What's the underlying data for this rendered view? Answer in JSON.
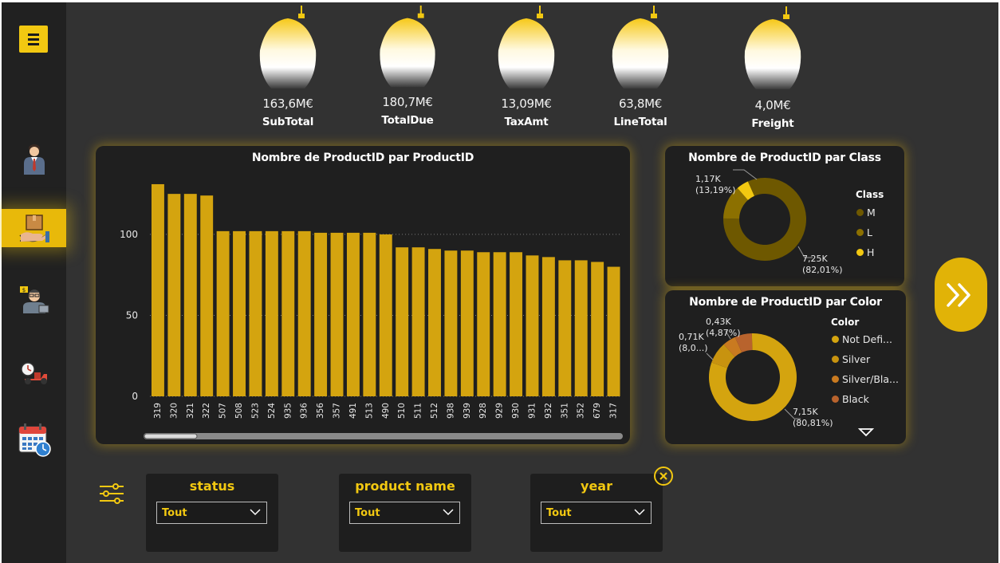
{
  "kpis": [
    {
      "value": "163,6M€",
      "label": "SubTotal"
    },
    {
      "value": "180,7M€",
      "label": "TotalDue"
    },
    {
      "value": "13,09M€",
      "label": "TaxAmt"
    },
    {
      "value": "63,8M€",
      "label": "LineTotal"
    },
    {
      "value": "4,0M€",
      "label": "Freight"
    }
  ],
  "sidebar": {
    "items": [
      {
        "icon": "businessman-icon"
      },
      {
        "icon": "product-delivery-icon",
        "active": true
      },
      {
        "icon": "seller-icon"
      },
      {
        "icon": "delivery-scooter-icon"
      },
      {
        "icon": "calendar-clock-icon"
      }
    ]
  },
  "filters": [
    {
      "title": "status",
      "value": "Tout"
    },
    {
      "title": "product name",
      "value": "Tout"
    },
    {
      "title": "year",
      "value": "Tout"
    }
  ],
  "chart_data": [
    {
      "type": "bar",
      "title": "Nombre de ProductID par ProductID",
      "xlabel": "",
      "ylabel": "",
      "ylim": [
        0,
        130
      ],
      "yticks": [
        0,
        50,
        100
      ],
      "categories": [
        "319",
        "320",
        "321",
        "322",
        "507",
        "508",
        "523",
        "524",
        "935",
        "936",
        "356",
        "357",
        "491",
        "513",
        "490",
        "510",
        "511",
        "512",
        "938",
        "939",
        "928",
        "929",
        "930",
        "931",
        "932",
        "351",
        "352",
        "679",
        "317"
      ],
      "values": [
        131,
        125,
        125,
        124,
        102,
        102,
        102,
        102,
        102,
        102,
        101,
        101,
        101,
        101,
        100,
        92,
        92,
        91,
        90,
        90,
        89,
        89,
        89,
        87,
        86,
        84,
        84,
        83,
        80
      ],
      "bar_color": "#d4a40f",
      "grid": "dotted at 50 and 100"
    },
    {
      "type": "pie",
      "donut": true,
      "title": "Nombre de ProductID par Class",
      "legend_title": "Class",
      "legend_position": "right",
      "categories": [
        "M",
        "L",
        "H"
      ],
      "values": [
        7250,
        1170,
        420
      ],
      "colors": [
        "#6e5800",
        "#8c7000",
        "#f2c811"
      ],
      "labels": [
        {
          "value": "7,25K",
          "pct": "(82,01%)"
        },
        {
          "value": "1,17K",
          "pct": "(13,19%)"
        }
      ]
    },
    {
      "type": "pie",
      "donut": true,
      "title": "Nombre de ProductID par Color",
      "legend_title": "Color",
      "legend_position": "right",
      "categories": [
        "Not Defi...",
        "Silver",
        "Silver/Bla...",
        "Black"
      ],
      "values": [
        7150,
        710,
        430,
        560
      ],
      "colors": [
        "#d4a40f",
        "#c8930f",
        "#c97a20",
        "#b8632d"
      ],
      "labels": [
        {
          "value": "7,15K",
          "pct": "(80,81%)"
        },
        {
          "value": "0,71K",
          "pct": "(8,0...)"
        },
        {
          "value": "0,43K",
          "pct": "(4,87%)"
        }
      ]
    }
  ]
}
